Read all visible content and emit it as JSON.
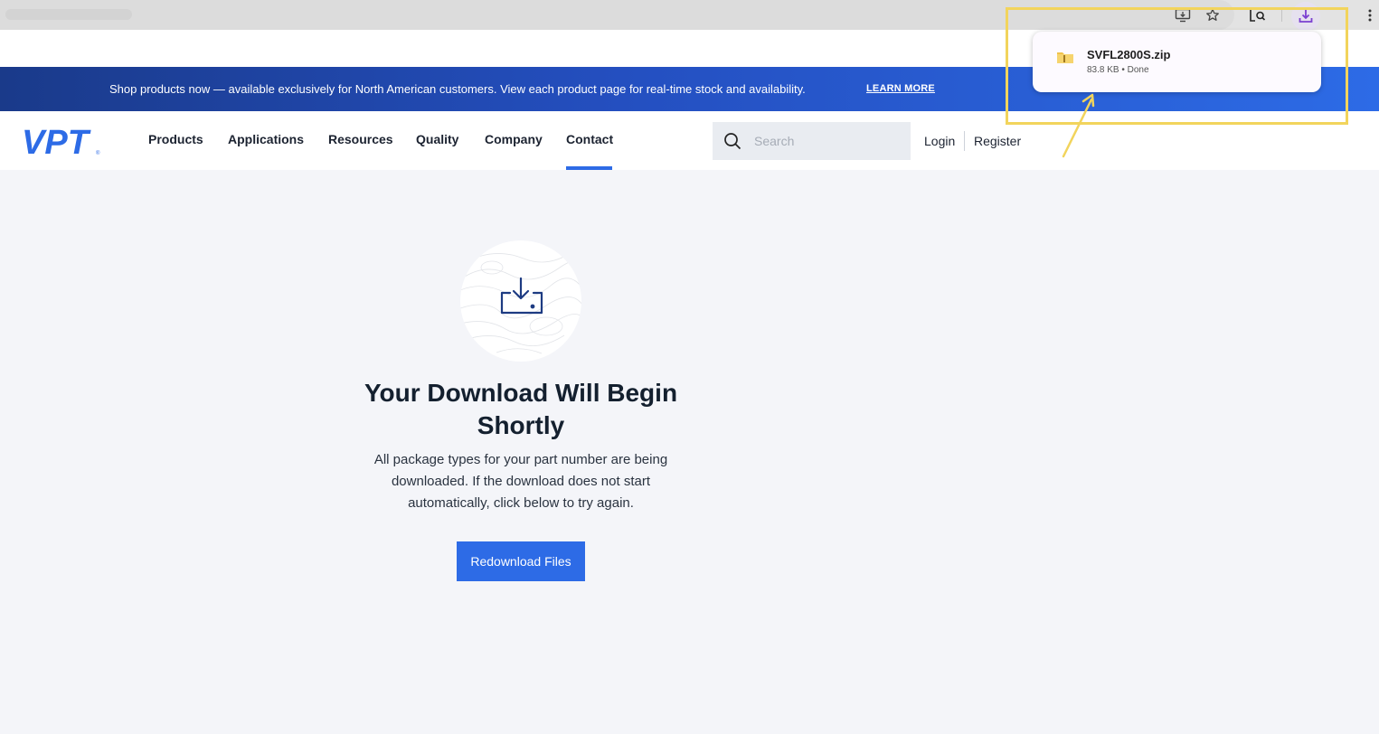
{
  "browser": {
    "toolbar_icons": [
      "install-app-icon",
      "bookmark-star-icon",
      "lens-search-icon",
      "download-icon",
      "more-menu-icon"
    ],
    "download_popup": {
      "file_name": "SVFL2800S.zip",
      "file_meta": "83.8 KB • Done"
    }
  },
  "banner": {
    "text": "Shop products now — available exclusively for North American customers. View each product page for real-time stock and availability.",
    "link_label": "LEARN MORE"
  },
  "navbar": {
    "logo_text": "VPT",
    "items": [
      {
        "label": "Products"
      },
      {
        "label": "Applications"
      },
      {
        "label": "Resources"
      },
      {
        "label": "Quality"
      },
      {
        "label": "Company"
      },
      {
        "label": "Contact"
      }
    ],
    "active_item": "Contact",
    "search_placeholder": "Search",
    "login_label": "Login",
    "register_label": "Register"
  },
  "main": {
    "title": "Your Download Will Begin Shortly",
    "description": "All package types for your part number are being downloaded. If the download does not start automatically, click below to try again.",
    "button_label": "Redownload Files"
  },
  "colors": {
    "accent": "#2d6be6",
    "banner_dark": "#1a3a8a",
    "annotation": "#f2d45c",
    "download_accent": "#7b3fd0"
  }
}
